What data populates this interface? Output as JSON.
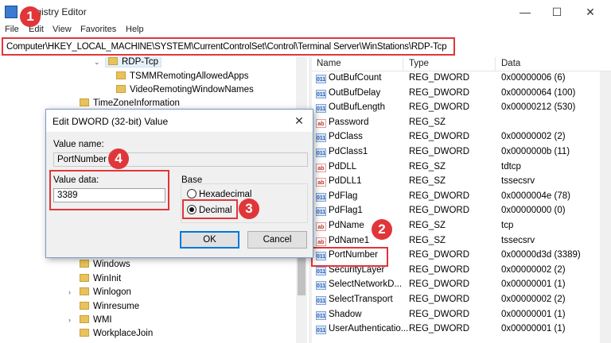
{
  "window": {
    "title": "Registry Editor",
    "minimize": "—",
    "maximize": "☐",
    "close": "✕"
  },
  "menu": [
    "File",
    "Edit",
    "View",
    "Favorites",
    "Help"
  ],
  "address": "Computer\\HKEY_LOCAL_MACHINE\\SYSTEM\\CurrentControlSet\\Control\\Terminal Server\\WinStations\\RDP-Tcp",
  "tree": {
    "top_items": [
      {
        "label": "RDP-Tcp",
        "chevron": "⌄"
      },
      {
        "label": "TSMMRemotingAllowedApps"
      },
      {
        "label": "VideoRemotingWindowNames"
      },
      {
        "label": "TimeZoneInformation"
      }
    ],
    "bottom_items": [
      {
        "label": "Windows"
      },
      {
        "label": "WinInit"
      },
      {
        "label": "Winlogon",
        "chevron": "›"
      },
      {
        "label": "Winresume"
      },
      {
        "label": "WMI",
        "chevron": "›"
      },
      {
        "label": "WorkplaceJoin"
      }
    ]
  },
  "list": {
    "headers": {
      "name": "Name",
      "type": "Type",
      "data": "Data"
    },
    "rows": [
      {
        "name": "OutBufCount",
        "type": "REG_DWORD",
        "data": "0x00000006 (6)",
        "kind": "bin"
      },
      {
        "name": "OutBufDelay",
        "type": "REG_DWORD",
        "data": "0x00000064 (100)",
        "kind": "bin"
      },
      {
        "name": "OutBufLength",
        "type": "REG_DWORD",
        "data": "0x00000212 (530)",
        "kind": "bin"
      },
      {
        "name": "Password",
        "type": "REG_SZ",
        "data": "",
        "kind": "sz"
      },
      {
        "name": "PdClass",
        "type": "REG_DWORD",
        "data": "0x00000002 (2)",
        "kind": "bin"
      },
      {
        "name": "PdClass1",
        "type": "REG_DWORD",
        "data": "0x0000000b (11)",
        "kind": "bin"
      },
      {
        "name": "PdDLL",
        "type": "REG_SZ",
        "data": "tdtcp",
        "kind": "sz"
      },
      {
        "name": "PdDLL1",
        "type": "REG_SZ",
        "data": "tssecsrv",
        "kind": "sz"
      },
      {
        "name": "PdFlag",
        "type": "REG_DWORD",
        "data": "0x0000004e (78)",
        "kind": "bin"
      },
      {
        "name": "PdFlag1",
        "type": "REG_DWORD",
        "data": "0x00000000 (0)",
        "kind": "bin"
      },
      {
        "name": "PdName",
        "type": "REG_SZ",
        "data": "tcp",
        "kind": "sz"
      },
      {
        "name": "PdName1",
        "type": "REG_SZ",
        "data": "tssecsrv",
        "kind": "sz"
      },
      {
        "name": "PortNumber",
        "type": "REG_DWORD",
        "data": "0x00000d3d (3389)",
        "kind": "bin"
      },
      {
        "name": "SecurityLayer",
        "type": "REG_DWORD",
        "data": "0x00000002 (2)",
        "kind": "bin"
      },
      {
        "name": "SelectNetworkD...",
        "type": "REG_DWORD",
        "data": "0x00000001 (1)",
        "kind": "bin"
      },
      {
        "name": "SelectTransport",
        "type": "REG_DWORD",
        "data": "0x00000002 (2)",
        "kind": "bin"
      },
      {
        "name": "Shadow",
        "type": "REG_DWORD",
        "data": "0x00000001 (1)",
        "kind": "bin"
      },
      {
        "name": "UserAuthenticatio...",
        "type": "REG_DWORD",
        "data": "0x00000001 (1)",
        "kind": "bin"
      }
    ]
  },
  "icons": {
    "bin": "011",
    "sz": "ab"
  },
  "dialog": {
    "title": "Edit DWORD (32-bit) Value",
    "close": "✕",
    "value_name_label": "Value name:",
    "value_name": "PortNumber",
    "value_data_label": "Value data:",
    "value_data": "3389",
    "base_label": "Base",
    "hex_label": "Hexadecimal",
    "dec_label": "Decimal",
    "selected_base": "Decimal",
    "ok": "OK",
    "cancel": "Cancel"
  },
  "badges": [
    "1",
    "2",
    "3",
    "4"
  ],
  "colors": {
    "highlight": "#e0363a",
    "selection": "#e5f0fb"
  }
}
